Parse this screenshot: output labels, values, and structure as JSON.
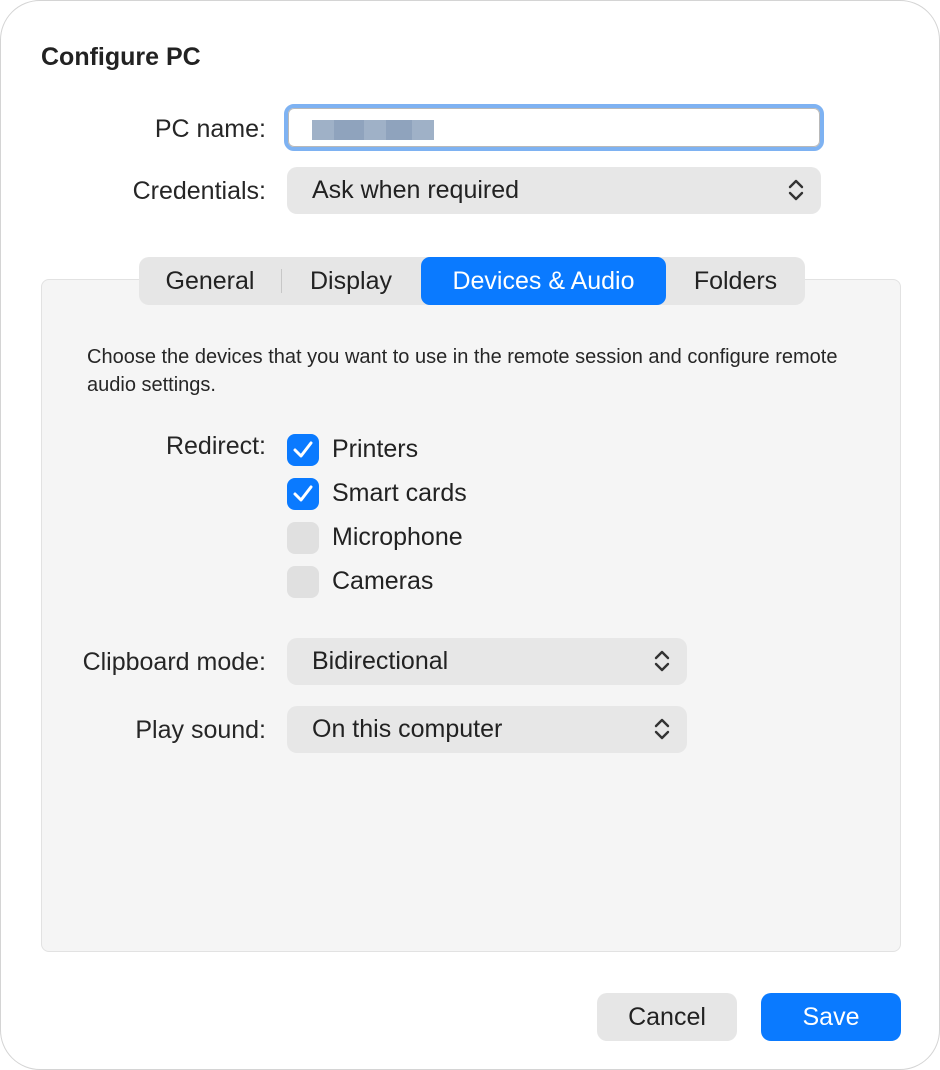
{
  "dialog": {
    "title": "Configure PC"
  },
  "pc_name": {
    "label": "PC name:",
    "value": ""
  },
  "credentials": {
    "label": "Credentials:",
    "value": "Ask when required"
  },
  "tabs": [
    {
      "label": "General",
      "selected": false
    },
    {
      "label": "Display",
      "selected": false
    },
    {
      "label": "Devices & Audio",
      "selected": true
    },
    {
      "label": "Folders",
      "selected": false
    }
  ],
  "devices_audio": {
    "description": "Choose the devices that you want to use in the remote session and configure remote audio settings.",
    "redirect_label": "Redirect:",
    "redirect_options": [
      {
        "label": "Printers",
        "checked": true
      },
      {
        "label": "Smart cards",
        "checked": true
      },
      {
        "label": "Microphone",
        "checked": false
      },
      {
        "label": "Cameras",
        "checked": false
      }
    ],
    "clipboard_mode": {
      "label": "Clipboard mode:",
      "value": "Bidirectional"
    },
    "play_sound": {
      "label": "Play sound:",
      "value": "On this computer"
    }
  },
  "buttons": {
    "cancel": "Cancel",
    "save": "Save"
  },
  "colors": {
    "accent": "#0a7aff",
    "focus_ring": "#7eb2f2"
  },
  "icons": {
    "select_chevron": "chevron-up-down-icon",
    "checkmark": "checkmark-icon"
  }
}
